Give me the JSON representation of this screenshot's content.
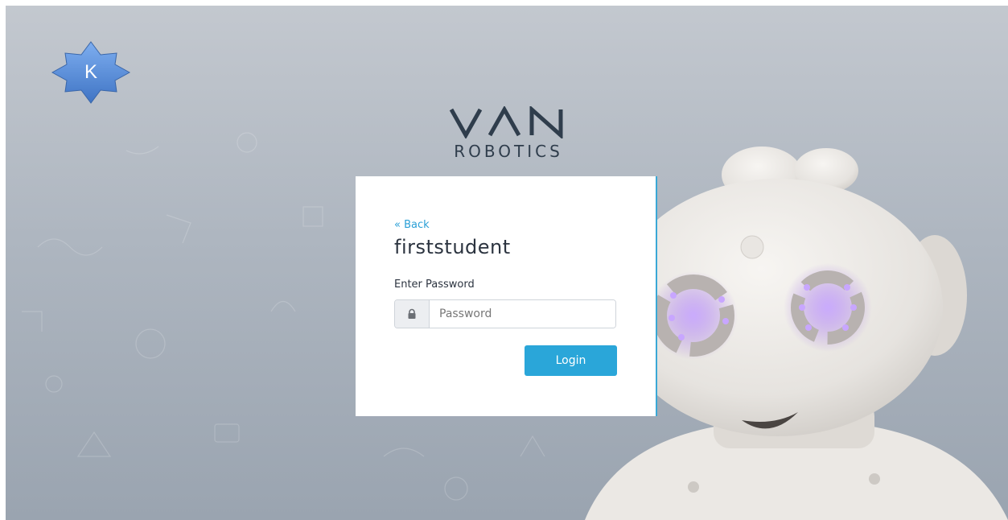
{
  "badge": {
    "letter": "K",
    "icon": "star-badge-icon",
    "color": "#5b8fd6"
  },
  "logo": {
    "wordmark": "VAN",
    "subtitle": "ROBOTICS"
  },
  "login_card": {
    "back_link": "« Back",
    "username": "firststudent",
    "password_label": "Enter Password",
    "password_placeholder": "Password",
    "password_value": "",
    "login_button": "Login",
    "lock_icon": "lock-icon"
  },
  "colors": {
    "accent": "#2aa6d9",
    "text_dark": "#2c3440",
    "logo_text": "#2f3d4c",
    "eye_glow": "#a070e0"
  }
}
